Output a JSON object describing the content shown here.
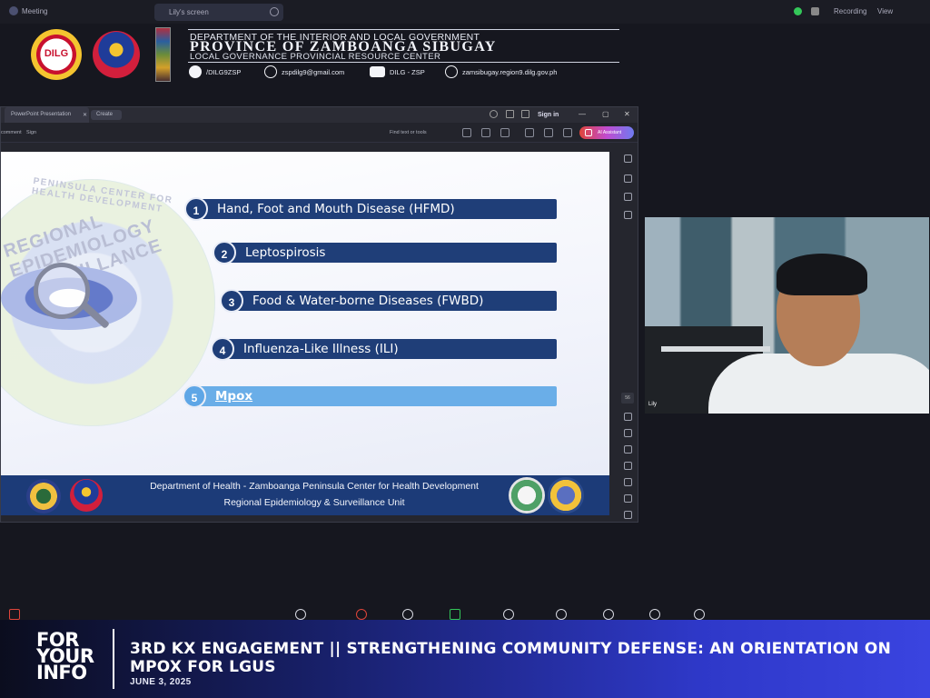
{
  "meeting": {
    "title": "Meeting",
    "share_label": "Lily's screen",
    "recording_label": "Recording",
    "view_label": "View"
  },
  "header": {
    "department": "DEPARTMENT OF THE INTERIOR AND LOCAL GOVERNMENT",
    "province": "PROVINCE OF ZAMBOANGA SIBUGAY",
    "center": "LOCAL GOVERNANCE PROVINCIAL RESOURCE CENTER",
    "logo_text": "DILG",
    "contacts": [
      {
        "icon": "facebook-icon",
        "text": "/DILG9ZSP"
      },
      {
        "icon": "email-icon",
        "text": "zspdilg9@gmail.com"
      },
      {
        "icon": "youtube-icon",
        "text": "DILG - ZSP"
      },
      {
        "icon": "globe-icon",
        "text": "zamsibugay.region9.dilg.gov.ph"
      }
    ]
  },
  "ppt": {
    "tab_label": "PowerPoint Presentation",
    "create_label": "Create",
    "sign_in": "Sign in",
    "toolbar": {
      "left1": "comment",
      "left2": "Sign",
      "find": "Find text or tools",
      "ai": "AI Assistant"
    },
    "rail_labels": [
      "56",
      "A"
    ]
  },
  "slide": {
    "emblem_text": "REGIONAL EPIDEMIOLOGY SURVEILLANCE UNIT",
    "emblem_ring": "PENINSULA CENTER FOR HEALTH DEVELOPMENT",
    "items": [
      {
        "num": "1",
        "label": "Hand, Foot and Mouth Disease (HFMD)"
      },
      {
        "num": "2",
        "label": "Leptospirosis"
      },
      {
        "num": "3",
        "label": "Food & Water-borne Diseases (FWBD)"
      },
      {
        "num": "4",
        "label": "Influenza-Like Illness (ILI)"
      },
      {
        "num": "5",
        "label": "Mpox"
      }
    ],
    "footer_line1": "Department of Health - Zamboanga Peninsula Center for Health Development",
    "footer_line2": "Regional Epidemiology & Surveillance Unit"
  },
  "camera": {
    "participant": "Lily"
  },
  "banner": {
    "brand_lines": [
      "FOR",
      "YOUR",
      "INFO"
    ],
    "title": "3RD KX ENGAGEMENT || STRENGTHENING COMMUNITY DEFENSE: AN ORIENTATION ON MPOX FOR LGUS",
    "date": "JUNE 3, 2025"
  },
  "colors": {
    "slide_bar": "#1f3e78",
    "active_bar": "#6aaee8",
    "banner_start": "#0b0d1e",
    "banner_end": "#3a44e0"
  }
}
